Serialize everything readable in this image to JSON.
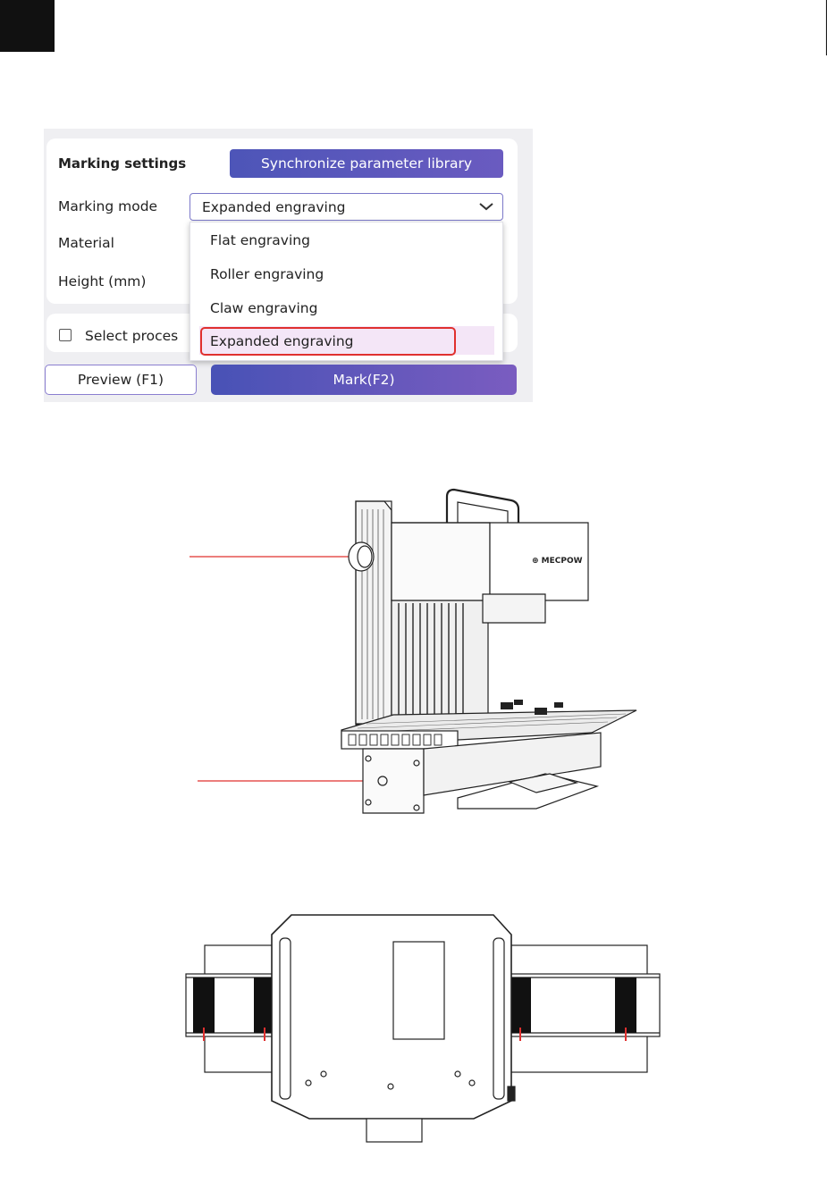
{
  "panel": {
    "heading": "Marking settings",
    "sync_button": "Synchronize parameter library",
    "marking_mode_label": "Marking mode",
    "marking_mode_value": "Expanded engraving",
    "material_label": "Material",
    "height_label": "Height (mm)",
    "select_process_label": "Select proces",
    "dropdown_options": [
      "Flat engraving",
      "Roller engraving",
      "Claw engraving",
      "Expanded engraving"
    ],
    "selected_option": "Expanded engraving",
    "preview_button": "Preview (F1)",
    "mark_button": "Mark(F2)"
  },
  "machine": {
    "brand": "MECPOW"
  },
  "colors": {
    "accent": "#5a56bd",
    "highlight": "#e0302f",
    "callout": "#e0302f"
  }
}
